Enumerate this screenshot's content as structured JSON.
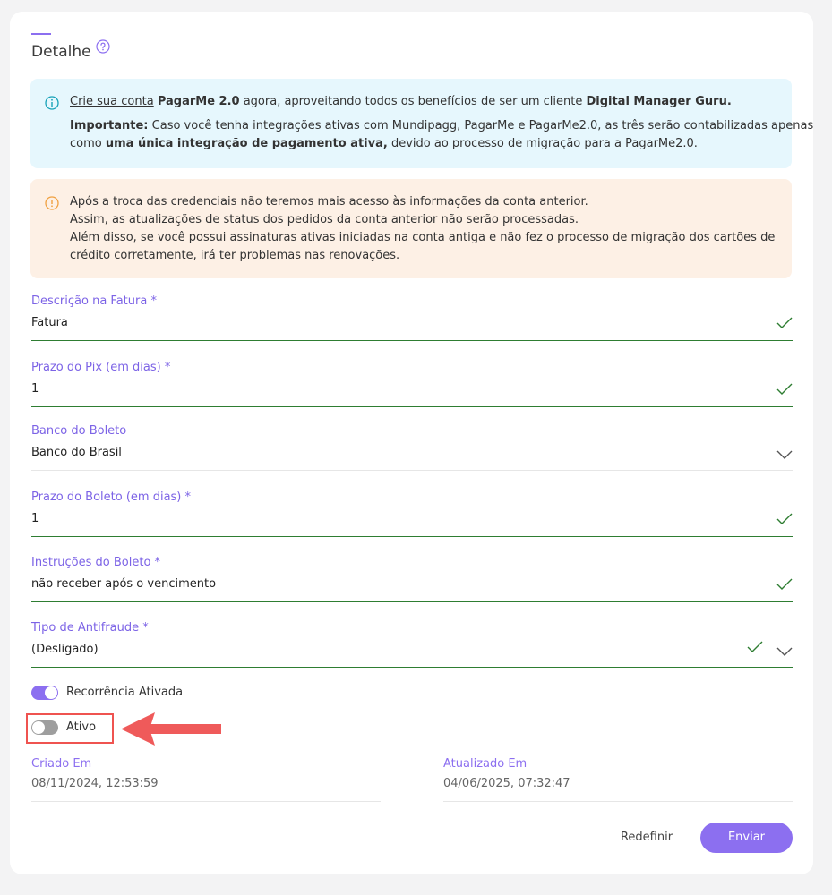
{
  "header": {
    "title": "Detalhe"
  },
  "colors": {
    "accent": "#8c6ff0",
    "success": "#2e7d32",
    "info_bg": "#e6f7fd",
    "warn_bg": "#fdf0e5",
    "highlight": "#ef5350"
  },
  "alerts": {
    "info": {
      "icon": "info-icon",
      "link": "Crie sua conta",
      "brand": "PagarMe 2.0",
      "text1": " agora, aproveitando todos os benefícios de ser um cliente ",
      "brand2": "Digital Manager Guru.",
      "important_label": "Importante:",
      "important_text": " Caso você tenha integrações ativas com Mundipagg, PagarMe e PagarMe2.0, as três serão contabilizadas apenas",
      "line3_prefix": "como ",
      "line3_bold": "uma única integração de pagamento ativa,",
      "line3_suffix": " devido ao processo de migração para a PagarMe2.0."
    },
    "warning": {
      "icon": "warning-icon",
      "lines": [
        "Após a troca das credenciais não teremos mais acesso às informações da conta anterior.",
        "Assim, as atualizações de status dos pedidos da conta anterior não serão processadas.",
        "Além disso, se você possui assinaturas ativas iniciadas na conta antiga e não fez o processo de migração dos cartões de",
        "crédito corretamente, irá ter problemas nas renovações."
      ]
    }
  },
  "fields": {
    "descricao": {
      "label": "Descrição na Fatura *",
      "value": "Fatura"
    },
    "prazo_pix": {
      "label": "Prazo do Pix (em dias) *",
      "value": "1"
    },
    "banco_boleto": {
      "label": "Banco do Boleto",
      "value": "Banco do Brasil"
    },
    "prazo_boleto": {
      "label": "Prazo do Boleto (em dias) *",
      "value": "1"
    },
    "instrucoes": {
      "label": "Instruções do Boleto *",
      "value": "não receber após o vencimento"
    },
    "antifraude": {
      "label": "Tipo de Antifraude *",
      "value": "(Desligado)"
    }
  },
  "toggles": {
    "recorrencia": {
      "label": "Recorrência Ativada",
      "on": true
    },
    "ativo": {
      "label": "Ativo",
      "on": false
    }
  },
  "meta": {
    "criado": {
      "label": "Criado Em",
      "value": "08/11/2024, 12:53:59"
    },
    "atualizado": {
      "label": "Atualizado Em",
      "value": "04/06/2025, 07:32:47"
    }
  },
  "actions": {
    "reset_label": "Redefinir",
    "submit_label": "Enviar"
  }
}
